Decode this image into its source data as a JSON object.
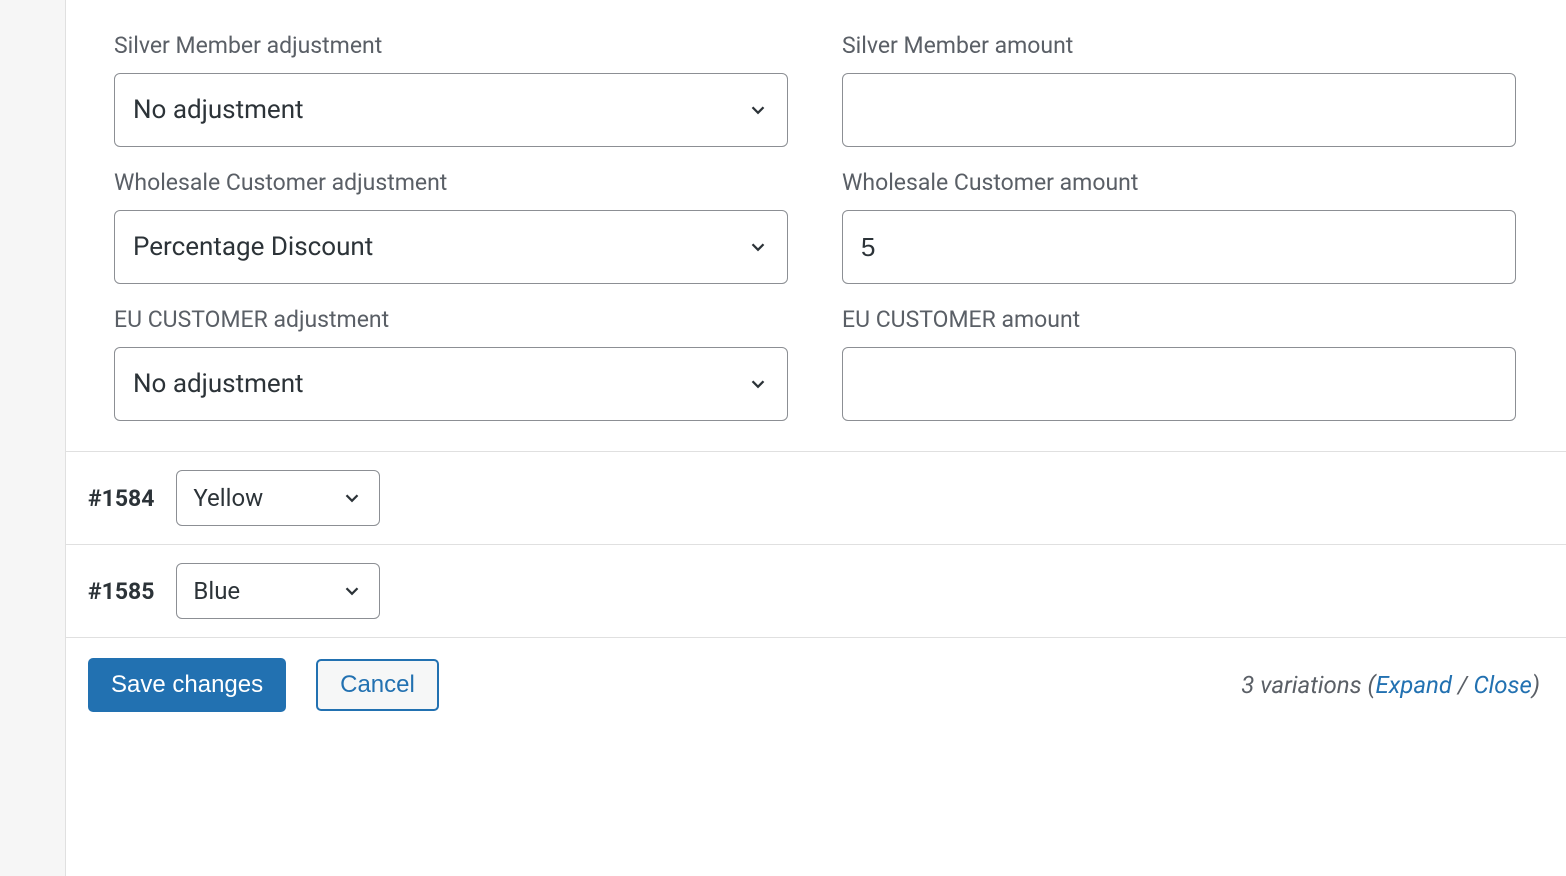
{
  "fields": {
    "silver": {
      "adjustment_label": "Silver Member adjustment",
      "adjustment_value": "No adjustment",
      "amount_label": "Silver Member amount",
      "amount_value": ""
    },
    "wholesale": {
      "adjustment_label": "Wholesale Customer adjustment",
      "adjustment_value": "Percentage Discount",
      "amount_label": "Wholesale Customer amount",
      "amount_value": "5"
    },
    "eu": {
      "adjustment_label": "EU CUSTOMER adjustment",
      "adjustment_value": "No adjustment",
      "amount_label": "EU CUSTOMER amount",
      "amount_value": ""
    }
  },
  "variations": [
    {
      "id": "#1584",
      "color": "Yellow"
    },
    {
      "id": "#1585",
      "color": "Blue"
    }
  ],
  "footer": {
    "save": "Save changes",
    "cancel": "Cancel",
    "count_text": "3 variations",
    "expand": "Expand",
    "close": "Close"
  }
}
